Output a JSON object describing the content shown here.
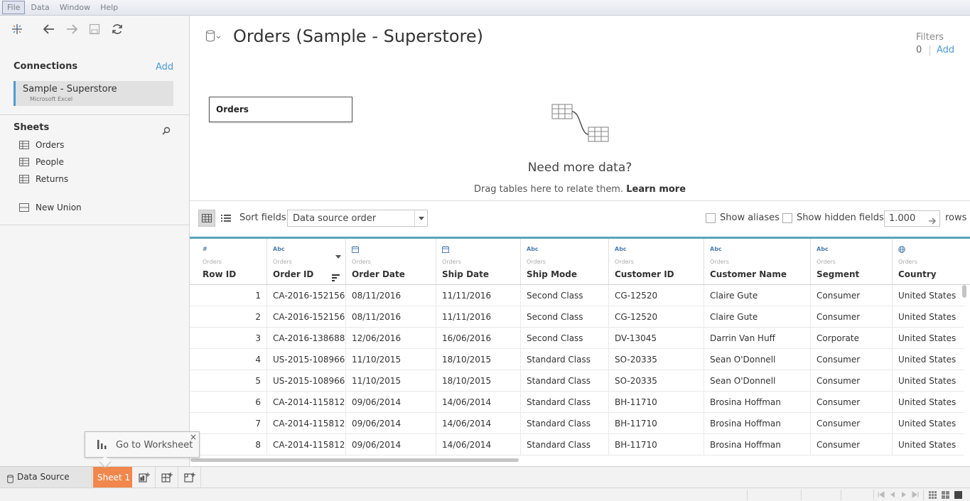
{
  "menu": [
    "File",
    "Data",
    "Window",
    "Help"
  ],
  "connections": {
    "title": "Connections",
    "add_label": "Add",
    "items": [
      {
        "name": "Sample - Superstore",
        "type": "Microsoft Excel"
      }
    ]
  },
  "sheets": {
    "title": "Sheets",
    "items": [
      "Orders",
      "People",
      "Returns"
    ],
    "new_union": "New Union"
  },
  "canvas": {
    "title": "Orders (Sample - Superstore)",
    "filters_label": "Filters",
    "filters_count": "0",
    "filters_add": "Add",
    "table_name": "Orders",
    "need_more": "Need more data?",
    "drag_hint": "Drag tables here to relate them.",
    "learn_more": "Learn more"
  },
  "gridbar": {
    "sort_label": "Sort fields",
    "sort_value": "Data source order",
    "show_aliases": "Show aliases",
    "show_hidden": "Show hidden fields",
    "rows_value": "1.000",
    "rows_label": "rows"
  },
  "grid": {
    "columns": [
      {
        "type": "#",
        "source": "Orders",
        "name": "Row ID"
      },
      {
        "type": "Abc",
        "source": "Orders",
        "name": "Order ID"
      },
      {
        "type": "date-icon",
        "source": "Orders",
        "name": "Order Date"
      },
      {
        "type": "date-icon",
        "source": "Orders",
        "name": "Ship Date"
      },
      {
        "type": "Abc",
        "source": "Orders",
        "name": "Ship Mode"
      },
      {
        "type": "Abc",
        "source": "Orders",
        "name": "Customer ID"
      },
      {
        "type": "Abc",
        "source": "Orders",
        "name": "Customer Name"
      },
      {
        "type": "Abc",
        "source": "Orders",
        "name": "Segment"
      },
      {
        "type": "globe-icon",
        "source": "Orders",
        "name": "Country"
      }
    ],
    "rows": [
      [
        "1",
        "CA-2016-152156",
        "08/11/2016",
        "11/11/2016",
        "Second Class",
        "CG-12520",
        "Claire Gute",
        "Consumer",
        "United States"
      ],
      [
        "2",
        "CA-2016-152156",
        "08/11/2016",
        "11/11/2016",
        "Second Class",
        "CG-12520",
        "Claire Gute",
        "Consumer",
        "United States"
      ],
      [
        "3",
        "CA-2016-138688",
        "12/06/2016",
        "16/06/2016",
        "Second Class",
        "DV-13045",
        "Darrin Van Huff",
        "Corporate",
        "United States"
      ],
      [
        "4",
        "US-2015-108966",
        "11/10/2015",
        "18/10/2015",
        "Standard Class",
        "SO-20335",
        "Sean O'Donnell",
        "Consumer",
        "United States"
      ],
      [
        "5",
        "US-2015-108966",
        "11/10/2015",
        "18/10/2015",
        "Standard Class",
        "SO-20335",
        "Sean O'Donnell",
        "Consumer",
        "United States"
      ],
      [
        "6",
        "CA-2014-115812",
        "09/06/2014",
        "14/06/2014",
        "Standard Class",
        "BH-11710",
        "Brosina Hoffman",
        "Consumer",
        "United States"
      ],
      [
        "7",
        "CA-2014-115812",
        "09/06/2014",
        "14/06/2014",
        "Standard Class",
        "BH-11710",
        "Brosina Hoffman",
        "Consumer",
        "United States"
      ],
      [
        "8",
        "CA-2014-115812",
        "09/06/2014",
        "14/06/2014",
        "Standard Class",
        "BH-11710",
        "Brosina Hoffman",
        "Consumer",
        "United States"
      ]
    ]
  },
  "tooltip": {
    "label": "Go to Worksheet",
    "close": "×"
  },
  "tabs": {
    "data_source": "Data Source",
    "sheet": "Sheet 1"
  },
  "colors": {
    "accent": "#4e9ad2",
    "sheet_tab": "#f1874c",
    "grid_header_line": "#5ba3bb"
  }
}
